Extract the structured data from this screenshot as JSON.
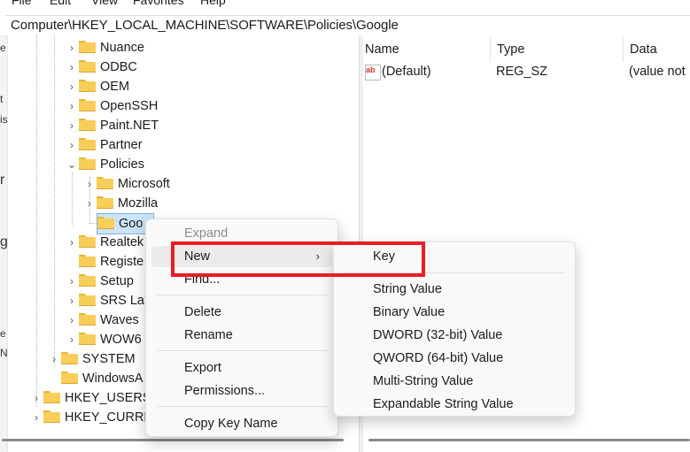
{
  "menubar": {
    "items": [
      "File",
      "Edit",
      "View",
      "Favorites",
      "Help"
    ]
  },
  "address": {
    "path": "Computer\\HKEY_LOCAL_MACHINE\\SOFTWARE\\Policies\\Google"
  },
  "leftstrip": {
    "fragments": [
      "e",
      "t",
      "is",
      "r",
      "g",
      "e",
      "N"
    ]
  },
  "tree": {
    "items": [
      "Nuance",
      "ODBC",
      "OEM",
      "OpenSSH",
      "Paint.NET",
      "Partner",
      "Policies",
      "Microsoft",
      "Mozilla",
      "Goo",
      "Realtek",
      "Registe",
      "Setup",
      "SRS Lal",
      "Waves",
      "WOW6",
      "SYSTEM",
      "WindowsA",
      "HKEY_USERS",
      "HKEY_CURRE"
    ]
  },
  "values_pane": {
    "columns": [
      "Name",
      "Type",
      "Data"
    ],
    "rows": [
      {
        "name": "(Default)",
        "type": "REG_SZ",
        "data": "(value not"
      }
    ]
  },
  "context_menu": {
    "expand": "Expand",
    "new": "New",
    "find": "Find...",
    "delete": "Delete",
    "rename": "Rename",
    "export": "Export",
    "permissions": "Permissions...",
    "copy_key_name": "Copy Key Name"
  },
  "submenu": {
    "key": "Key",
    "string_value": "String Value",
    "binary_value": "Binary Value",
    "dword_value": "DWORD (32-bit) Value",
    "qword_value": "QWORD (64-bit) Value",
    "multi_string_value": "Multi-String Value",
    "expandable_string_value": "Expandable String Value"
  },
  "colors": {
    "highlight": "#ec1c24",
    "folder": "#f8ce58"
  }
}
